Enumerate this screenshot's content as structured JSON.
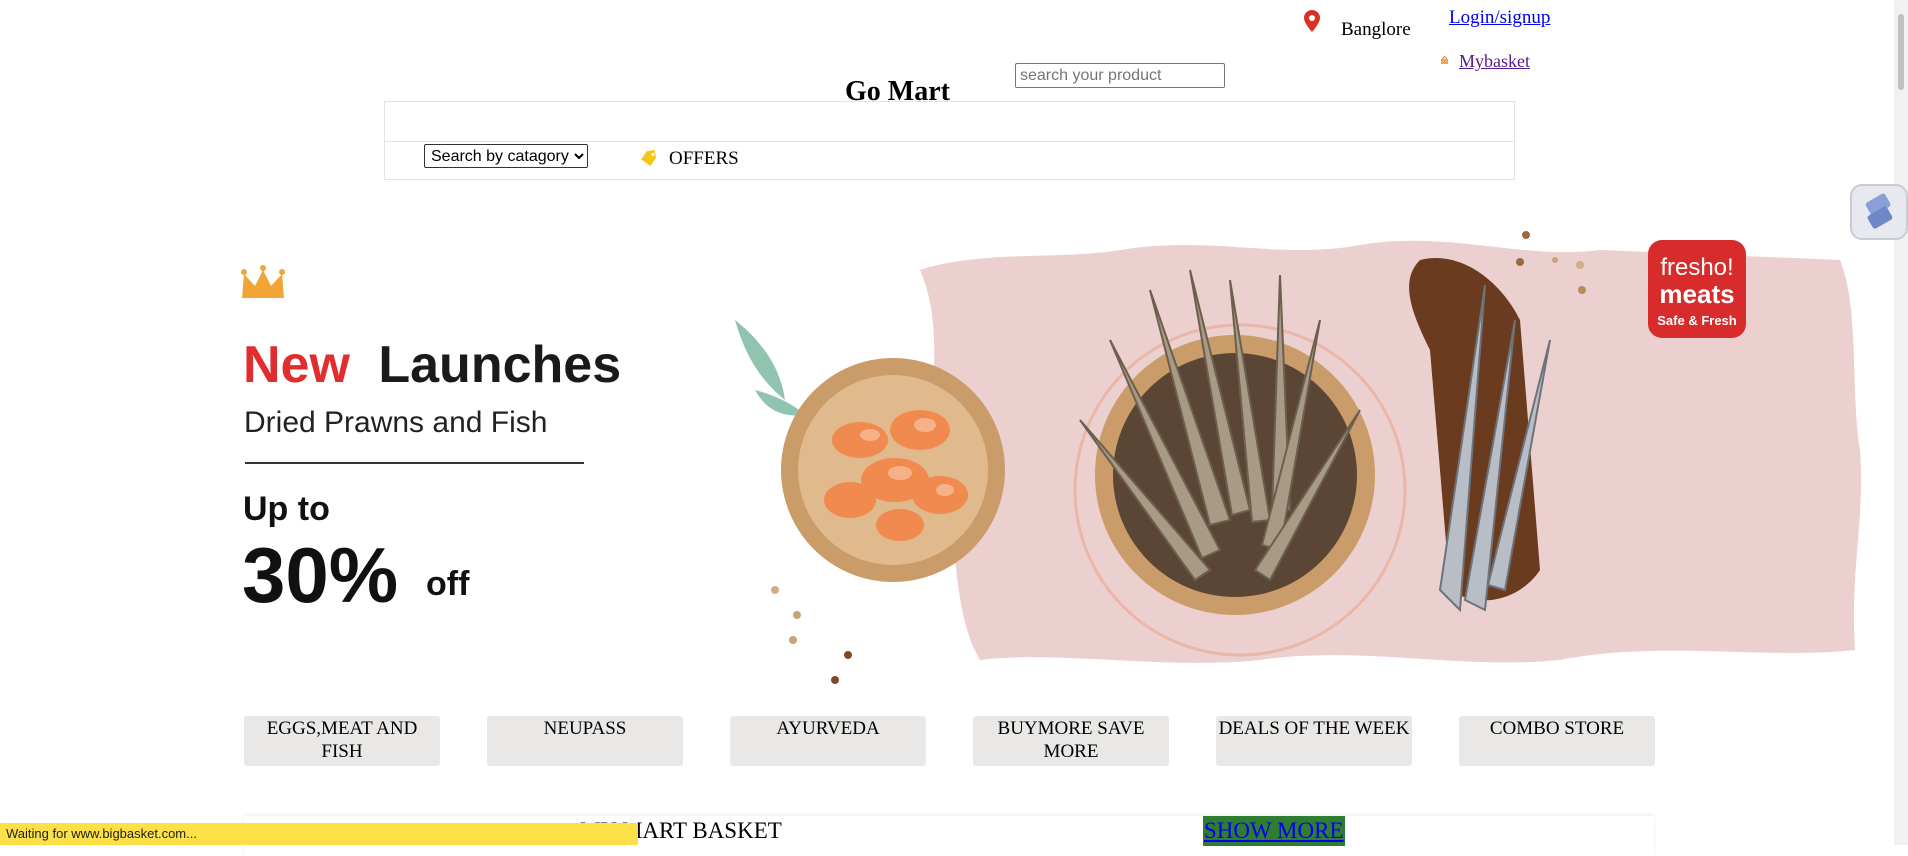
{
  "header": {
    "location": "Banglore",
    "login_label": "Login/signup",
    "basket_label": "Mybasket",
    "brand": "Go Mart",
    "search_placeholder": "search your product",
    "category_select": "Search by catagory",
    "offers_label": "OFFERS"
  },
  "banner": {
    "title_accent": "New",
    "title": "Launches",
    "subtitle": "Dried Prawns and Fish",
    "upto": "Up to",
    "percent": "30%",
    "off": "off",
    "logo_line1": "fresho!",
    "logo_line2": "meats",
    "logo_line3": "Safe & Fresh",
    "accent_color": "#e12d2d",
    "brand_color": "#d82b2b",
    "splash_color": "#ecd0cf"
  },
  "categories": [
    "EGGS,MEAT AND FISH",
    "NEUPASS",
    "AYURVEDA",
    "BUYMORE SAVE MORE",
    "DEALS OF THE WEEK",
    "COMBO STORE"
  ],
  "basket_section": {
    "title": "MY MART BASKET",
    "show_more": "SHOW MORE"
  },
  "status_bar": "Waiting for www.bigbasket.com..."
}
